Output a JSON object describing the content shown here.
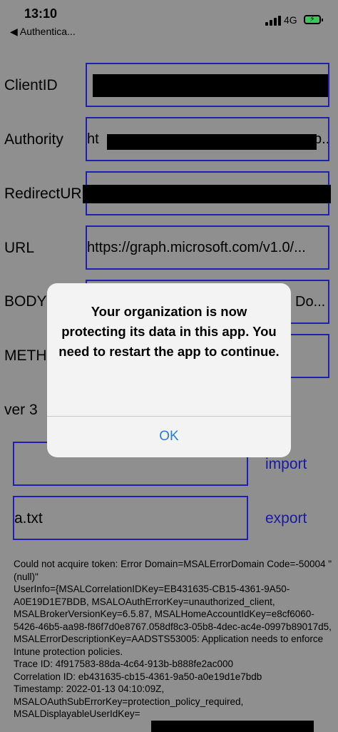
{
  "status_bar": {
    "time": "13:10",
    "back_label": "◀ Authentica...",
    "network": "4G"
  },
  "form": {
    "client_id_label": "ClientID",
    "client_id_value": "",
    "authority_label": "Authority",
    "authority_value": "ht",
    "authority_tail": "p...",
    "redirect_label": "RedirectUR",
    "url_label": "URL",
    "url_value": "https://graph.microsoft.com/v1.0/...",
    "body_label": "BODY",
    "body_value": "Do...",
    "method_label": "METH",
    "version_label": "ver 3"
  },
  "files": {
    "import_value": "",
    "import_label": "import",
    "export_value": "a.txt",
    "export_label": "export"
  },
  "log_text": "Could not acquire token: Error Domain=MSALErrorDomain Code=-50004 \"(null)\"\nUserInfo={MSALCorrelationIDKey=EB431635-CB15-4361-9A50-A0E19D1E7BDB, MSALOAuthErrorKey=unauthorized_client, MSALBrokerVersionKey=6.5.87, MSALHomeAccountIdKey=e8cf6060-5426-46b5-aa98-f86f7d0e8767.058df8c3-05b8-4dec-ac4e-0997b89017d5, MSALErrorDescriptionKey=AADSTS53005: Application needs to enforce Intune protection policies.\nTrace ID: 4f917583-88da-4c64-913b-b888fe2ac000\nCorrelation ID: eb431635-cb15-4361-9a50-a0e19d1e7bdb\nTimestamp: 2022-01-13 04:10:09Z, MSALOAuthSubErrorKey=protection_policy_required, MSALDisplayableUserIdKey=",
  "alert": {
    "message": "Your organization is now protecting its data in this app. You need to restart the app to continue.",
    "ok_label": "OK"
  },
  "colors": {
    "field_border": "#2020b0",
    "link": "#1a1aa0",
    "alert_button": "#2a7ae2",
    "battery": "#33cc55"
  }
}
